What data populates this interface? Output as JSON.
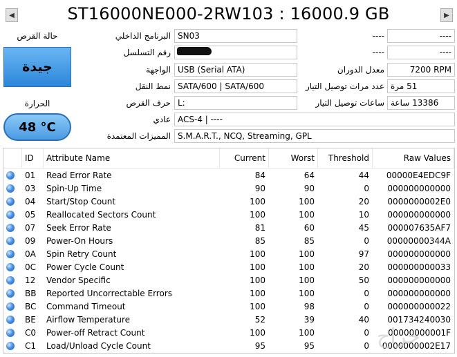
{
  "title": "ST16000NE000-2RW103 : 16000.9 GB",
  "nav": {
    "prev": "◀",
    "next": "▶"
  },
  "health": {
    "label": "حالة القرص",
    "status": "جيدة",
    "color": "#3b8ee0"
  },
  "temperature": {
    "label": "الحرارة",
    "value": "48 °C"
  },
  "fields": {
    "firmware": {
      "label": "البرنامج الداخلي",
      "value": "SN03"
    },
    "serial": {
      "label": "رقم التسلسل",
      "value": ""
    },
    "interface": {
      "label": "الواجهة",
      "value": "USB (Serial ATA)"
    },
    "transfer_mode": {
      "label": "نمط النقل",
      "value": "SATA/600 | SATA/600"
    },
    "drive_letter": {
      "label": "حرف القرص",
      "value": "L:"
    },
    "standard": {
      "label": "عادي",
      "value": "ACS-4 | ----"
    },
    "features": {
      "label": "المميزات المعتمدة",
      "value": "S.M.A.R.T., NCQ, Streaming, GPL"
    },
    "right1": {
      "value": "----"
    },
    "right2": {
      "value": "----"
    },
    "rotation_rate": {
      "label": "معدل الدوران",
      "value": "7200 RPM"
    },
    "power_on_count": {
      "label": "عدد مرات توصيل التيار",
      "value": "51 مرة"
    },
    "power_on_hours": {
      "label": "ساعات توصيل التيار",
      "value": "13386 ساعة"
    },
    "mid1": {
      "value": "----"
    },
    "mid2": {
      "value": "----"
    }
  },
  "table": {
    "headers": [
      "ID",
      "Attribute Name",
      "Current",
      "Worst",
      "Threshold",
      "Raw Values"
    ],
    "rows": [
      [
        "01",
        "Read Error Rate",
        "84",
        "64",
        "44",
        "00000E4EDC9F"
      ],
      [
        "03",
        "Spin-Up Time",
        "90",
        "90",
        "0",
        "000000000000"
      ],
      [
        "04",
        "Start/Stop Count",
        "100",
        "100",
        "20",
        "0000000002E0"
      ],
      [
        "05",
        "Reallocated Sectors Count",
        "100",
        "100",
        "10",
        "000000000000"
      ],
      [
        "07",
        "Seek Error Rate",
        "81",
        "60",
        "45",
        "000007635AF7"
      ],
      [
        "09",
        "Power-On Hours",
        "85",
        "85",
        "0",
        "00000000344A"
      ],
      [
        "0A",
        "Spin Retry Count",
        "100",
        "100",
        "97",
        "000000000000"
      ],
      [
        "0C",
        "Power Cycle Count",
        "100",
        "100",
        "20",
        "000000000033"
      ],
      [
        "12",
        "Vendor Specific",
        "100",
        "100",
        "50",
        "000000000000"
      ],
      [
        "BB",
        "Reported Uncorrectable Errors",
        "100",
        "100",
        "0",
        "000000000000"
      ],
      [
        "BC",
        "Command Timeout",
        "100",
        "98",
        "0",
        "000000000022"
      ],
      [
        "BE",
        "Airflow Temperature",
        "52",
        "39",
        "40",
        "001734240030"
      ],
      [
        "C0",
        "Power-off Retract Count",
        "100",
        "100",
        "0",
        "00000000001F"
      ],
      [
        "C1",
        "Load/Unload Cycle Count",
        "95",
        "95",
        "0",
        "0000000002E17"
      ]
    ]
  }
}
